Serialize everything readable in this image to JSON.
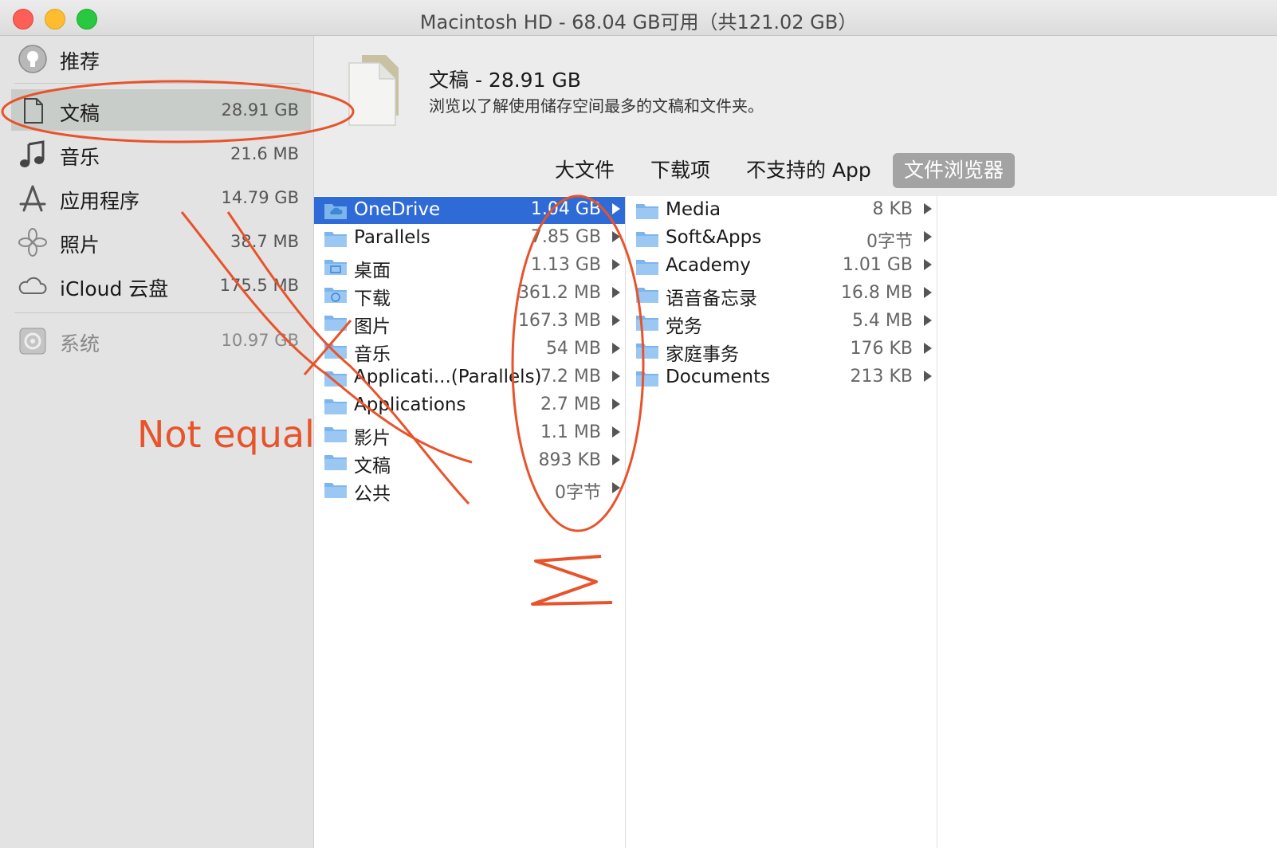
{
  "window": {
    "title": "Macintosh HD - 68.04 GB可用（共121.02 GB）"
  },
  "sidebar": {
    "items": [
      {
        "label": "推荐",
        "size": "",
        "icon": "lightbulb-icon"
      },
      {
        "label": "文稿",
        "size": "28.91 GB",
        "icon": "document-icon",
        "selected": true
      },
      {
        "label": "音乐",
        "size": "21.6 MB",
        "icon": "music-note-icon"
      },
      {
        "label": "应用程序",
        "size": "14.79 GB",
        "icon": "app-store-icon"
      },
      {
        "label": "照片",
        "size": "38.7 MB",
        "icon": "photos-icon"
      },
      {
        "label": "iCloud 云盘",
        "size": "175.5 MB",
        "icon": "cloud-icon"
      },
      {
        "label": "系统",
        "size": "10.97 GB",
        "icon": "system-icon"
      }
    ]
  },
  "header": {
    "title": "文稿 - 28.91 GB",
    "subtitle": "浏览以了解使用储存空间最多的文稿和文件夹。"
  },
  "tabs": [
    {
      "label": "大文件"
    },
    {
      "label": "下载项"
    },
    {
      "label": "不支持的 App"
    },
    {
      "label": "文件浏览器",
      "active": true
    }
  ],
  "column1": [
    {
      "name": "OneDrive",
      "size": "1.04 GB",
      "selected": true
    },
    {
      "name": "Parallels",
      "size": "7.85 GB"
    },
    {
      "name": "桌面",
      "size": "1.13 GB"
    },
    {
      "name": "下载",
      "size": "361.2 MB"
    },
    {
      "name": "图片",
      "size": "167.3 MB"
    },
    {
      "name": "音乐",
      "size": "54 MB"
    },
    {
      "name": "Applicati...(Parallels)",
      "size": "7.2 MB"
    },
    {
      "name": "Applications",
      "size": "2.7 MB"
    },
    {
      "name": "影片",
      "size": "1.1 MB"
    },
    {
      "name": "文稿",
      "size": "893 KB"
    },
    {
      "name": "公共",
      "size": "0字节"
    }
  ],
  "column2": [
    {
      "name": "Media",
      "size": "8 KB"
    },
    {
      "name": "Soft&Apps",
      "size": "0字节"
    },
    {
      "name": "Academy",
      "size": "1.01 GB"
    },
    {
      "name": "语音备忘录",
      "size": "16.8 MB"
    },
    {
      "name": "党务",
      "size": "5.4 MB"
    },
    {
      "name": "家庭事务",
      "size": "176 KB"
    },
    {
      "name": "Documents",
      "size": "213 KB"
    }
  ],
  "annotation": {
    "text": "Not equal",
    "color": "#e8532b"
  }
}
